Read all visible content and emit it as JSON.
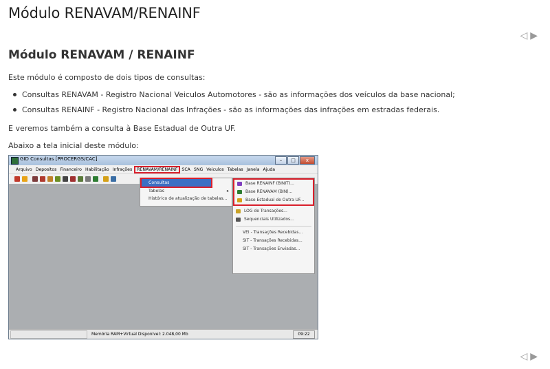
{
  "page": {
    "title": "Módulo RENAVAM/RENAINF",
    "nav_prev": "◁",
    "nav_next": "▶"
  },
  "content": {
    "subtitle": "Módulo RENAVAM / RENAINF",
    "intro": "Este módulo é composto de dois tipos de consultas:",
    "bullets": [
      "Consultas RENAVAM - Registro Nacional Veiculos Automotores - são as informações dos veículos da base nacional;",
      "Consultas RENAINF - Registro Nacional das Infrações - são as informações das infrações em estradas federais."
    ],
    "also": "E veremos também a consulta à Base Estadual de Outra UF.",
    "below": "Abaixo a tela inicial deste módulo:"
  },
  "screenshot": {
    "window_title": "GID Consultas [PROCERGS/CAC]",
    "window_buttons": [
      "–",
      "□",
      "x"
    ],
    "menubar": [
      "Arquivo",
      "Depositos",
      "Financeiro",
      "Habilitação",
      "Infrações",
      "RENAVAM/RENAINF",
      "SCA",
      "SNG",
      "Veiculos",
      "Tabelas",
      "Janela",
      "Ajuda"
    ],
    "menu_level1": [
      {
        "label": "Consultas",
        "arrow": "▸"
      },
      {
        "label": "Tabelas",
        "arrow": "▸"
      },
      {
        "label": "Histórico de atualização de tabelas..."
      }
    ],
    "menu_level2_group": [
      {
        "label": "Base RENAINF (BINIT)...",
        "icon": "renainf-icon"
      },
      {
        "label": "Base RENAVAM (BIN)...",
        "icon": "renavam-icon"
      },
      {
        "label": "Base Estadual de Outra UF...",
        "icon": "search-icon"
      }
    ],
    "menu_level2_rest": [
      {
        "label": "LOG de Transações...",
        "icon": "log-icon"
      },
      {
        "label": "Sequenciais Utilizados...",
        "icon": "sequence-icon"
      }
    ],
    "menu_level2_trans": [
      "VEI - Transações Recebidas...",
      "SIT - Transações Recebidas...",
      "SIT - Transações Enviadas..."
    ],
    "status_memory": "Memória RAM+Virtual Disponível: 2.048,00 Mb",
    "status_time": "09:22"
  },
  "colors": {
    "highlight": "#d91f2b",
    "selection": "#3b6fc4",
    "client_bg": "#abaeb1"
  }
}
